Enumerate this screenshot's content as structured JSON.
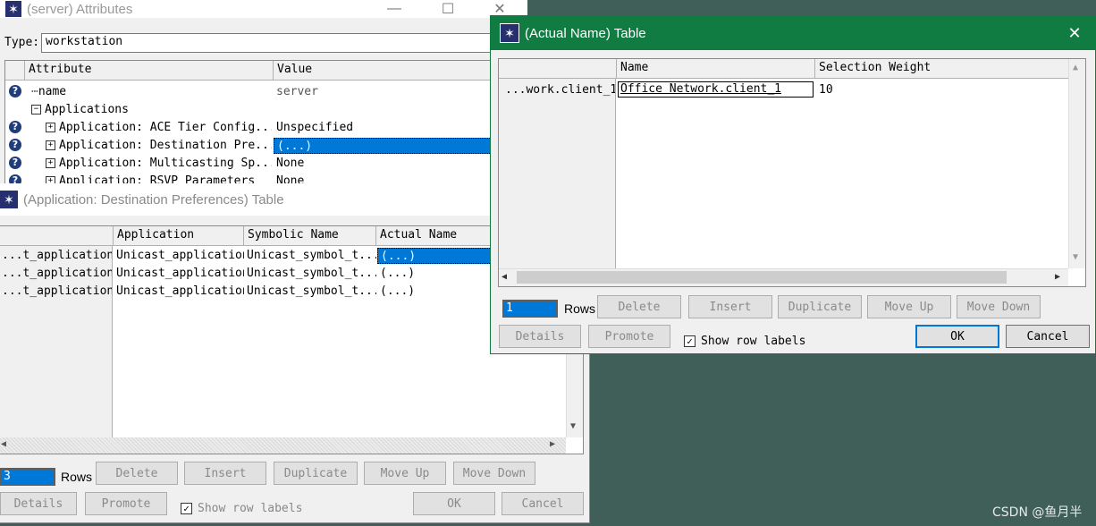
{
  "attributes_window": {
    "title": "(server) Attributes",
    "minimize_glyph": "—",
    "maximize_glyph": "☐",
    "close_glyph": "✕",
    "type_label": "Type:",
    "type_value": "workstation",
    "columns": [
      "Attribute",
      "Value"
    ],
    "rows": [
      {
        "attribute": "name",
        "value": "server"
      },
      {
        "attribute": "Applications",
        "value": ""
      },
      {
        "attribute": "Application: ACE Tier Config...",
        "value": "Unspecified"
      },
      {
        "attribute": "Application: Destination Pre...",
        "value": "(...)"
      },
      {
        "attribute": "Application: Multicasting Sp...",
        "value": "None"
      },
      {
        "attribute": "Application: RSVP Parameters",
        "value": "None"
      }
    ]
  },
  "dest_pref_window": {
    "title": "(Application: Destination Preferences) Table",
    "columns": [
      "Application",
      "Symbolic Name",
      "Actual Name"
    ],
    "rows": [
      {
        "label": "...t_application",
        "application": "Unicast_application",
        "symbolic": "Unicast_symbol_t...",
        "actual": "(...)"
      },
      {
        "label": "...t_application",
        "application": "Unicast_application",
        "symbolic": "Unicast_symbol_t...",
        "actual": "(...)"
      },
      {
        "label": "...t_application",
        "application": "Unicast_application",
        "symbolic": "Unicast_symbol_t...",
        "actual": "(...)"
      }
    ],
    "rows_count": "3",
    "rows_label": "Rows",
    "buttons": {
      "delete": "Delete",
      "insert": "Insert",
      "duplicate": "Duplicate",
      "move_up": "Move Up",
      "move_down": "Move Down",
      "details": "Details",
      "promote": "Promote",
      "ok": "OK",
      "cancel": "Cancel"
    },
    "show_row_labels": "Show row labels"
  },
  "actual_name_window": {
    "title": "(Actual Name) Table",
    "close_glyph": "✕",
    "columns": [
      "Name",
      "Selection Weight"
    ],
    "rows": [
      {
        "label": "...work.client_1",
        "name": "Office Network.client_1",
        "weight": "10"
      }
    ],
    "rows_count": "1",
    "rows_label": "Rows",
    "buttons": {
      "delete": "Delete",
      "insert": "Insert",
      "duplicate": "Duplicate",
      "move_up": "Move Up",
      "move_down": "Move Down",
      "details": "Details",
      "promote": "Promote",
      "ok": "OK",
      "cancel": "Cancel"
    },
    "show_row_labels": "Show row labels",
    "show_row_labels_checked": true
  },
  "watermark": "CSDN @鱼月半",
  "colors": {
    "desktop": "#3f5f58",
    "active_title": "#107c41",
    "selection": "#0078d7"
  }
}
